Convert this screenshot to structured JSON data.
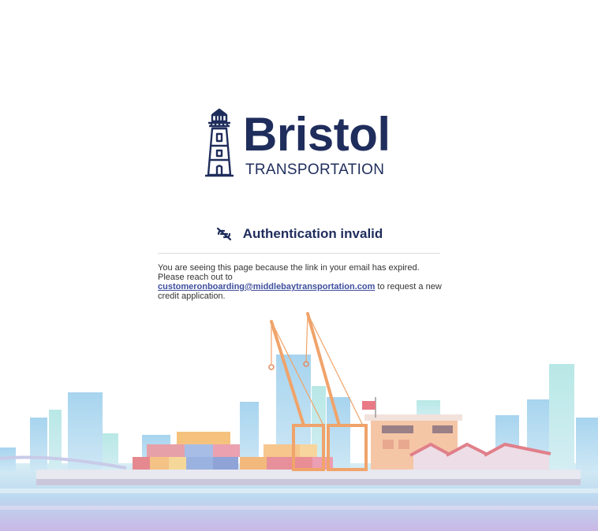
{
  "logo": {
    "brand": "Bristol",
    "subtitle": "TRANSPORTATION"
  },
  "heading": {
    "icon": "broken-link-icon",
    "title": "Authentication invalid"
  },
  "message": {
    "before": "You are seeing this page because the link in your email has expired. Please reach out to ",
    "email": "customeronboarding@middlebaytransportation.com",
    "after": " to request a new credit application."
  },
  "colors": {
    "brand": "#1f2d5c",
    "link": "#3f4f9e",
    "text": "#333333",
    "divider": "#dcdcdc"
  }
}
